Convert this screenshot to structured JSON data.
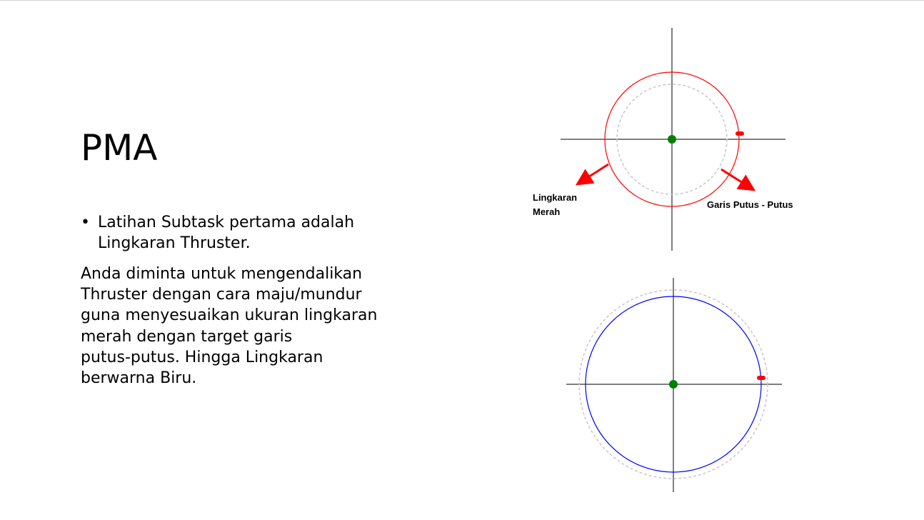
{
  "slide": {
    "title": "PMA",
    "bullet": {
      "marker": "•",
      "lines": [
        "Latihan Subtask pertama adalah",
        "Lingkaran Thruster."
      ]
    },
    "paragraph_lines": [
      "Anda diminta untuk mengendalikan",
      "Thruster dengan cara maju/mundur",
      "guna menyesuaikan ukuran lingkaran",
      "merah dengan target garis",
      "putus-putus. Hingga Lingkaran",
      "berwarna Biru."
    ]
  },
  "diagram_top": {
    "label_left_line1": "Lingkaran",
    "label_left_line2": "Merah",
    "label_right": "Garis Putus - Putus",
    "circle_color": "#ff0000",
    "dashed_color": "#c8c8c8",
    "center_color": "#008000",
    "marker_color": "#ff0000",
    "arrow_color": "#ff0000"
  },
  "diagram_bottom": {
    "circle_color": "#0000ff",
    "dashed_color": "#c8c8c8",
    "center_color": "#008000",
    "marker_color": "#ff0000"
  }
}
